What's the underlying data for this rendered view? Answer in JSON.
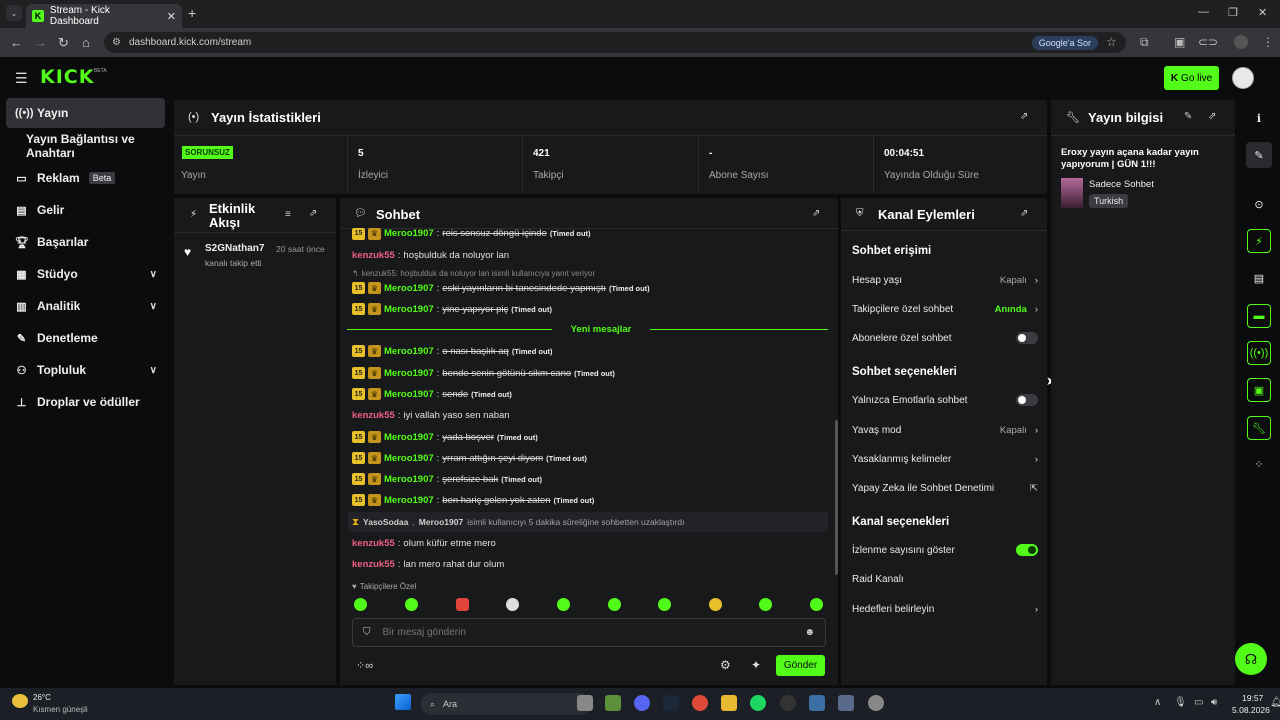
{
  "browser": {
    "tab_title": "Stream - Kick Dashboard",
    "tab_close": "✕",
    "new_tab": "+",
    "url": "dashboard.kick.com/stream",
    "google_sor": "Google'a Sor"
  },
  "header": {
    "logo": "KICK",
    "logo_beta": "BETA",
    "go_live": "Go live"
  },
  "sidebar": {
    "items": [
      {
        "label": "Yayın",
        "icon": "broadcast-icon"
      },
      {
        "label": "Yayın Bağlantısı ve Anahtarı",
        "icon": ""
      },
      {
        "label": "Reklam",
        "icon": "ad-icon",
        "badge": "Beta"
      },
      {
        "label": "Gelir",
        "icon": "revenue-icon"
      },
      {
        "label": "Başarılar",
        "icon": "trophy-icon"
      },
      {
        "label": "Stüdyo",
        "icon": "studio-icon"
      },
      {
        "label": "Analitik",
        "icon": "analytics-icon"
      },
      {
        "label": "Denetleme",
        "icon": "moderation-icon"
      },
      {
        "label": "Topluluk",
        "icon": "community-icon"
      },
      {
        "label": "Droplar ve ödüller",
        "icon": "drops-icon"
      }
    ]
  },
  "stats": {
    "title": "Yayın İstatistikleri",
    "status_badge": "SORUNSUZ",
    "status_label": "Yayın",
    "viewers_value": "5",
    "viewers_label": "İzleyici",
    "followers_value": "421",
    "followers_label": "Takipçi",
    "subs_value": "-",
    "subs_label": "Abone Sayısı",
    "uptime_value": "00:04:51",
    "uptime_label": "Yayında Olduğu Süre"
  },
  "activity": {
    "title": "Etkinlik Akışı",
    "user": "S2GNathan7",
    "time": "20 saat önce",
    "text": "kanalı takip etti"
  },
  "chat": {
    "title": "Sohbet",
    "lines": [
      {
        "user": "Meroo1907",
        "msg": "reis sonsuz döngü içinde",
        "to": "(Timed out)"
      },
      {
        "user": "kenzuk55",
        "msg": "hoşbulduk da noluyor lan"
      },
      {
        "reply": "kenzuk55: hoşbulduk da noluyor lan isimli kullanıcıya yanıt veriyor"
      },
      {
        "user": "Meroo1907",
        "msg": "eski yayınların bi tanesindede yapmıştı",
        "to": "(Timed out)"
      },
      {
        "user": "Meroo1907",
        "msg": "yine yapıyor piç",
        "to": "(Timed out)"
      },
      {
        "user": "Meroo1907",
        "msg": "o nası başlık aq",
        "to": "(Timed out)"
      },
      {
        "user": "Meroo1907",
        "msg": "bende senin götünü sikm cano",
        "to": "(Timed out)"
      },
      {
        "user": "Meroo1907",
        "msg": "sende",
        "to": "(Timed out)"
      },
      {
        "user": "kenzuk55",
        "msg": "iyi vallah yaso sen naban"
      },
      {
        "user": "Meroo1907",
        "msg": "yada boşver",
        "to": "(Timed out)"
      },
      {
        "user": "Meroo1907",
        "msg": "yrram attığın şeyi diyom",
        "to": "(Timed out)"
      },
      {
        "user": "Meroo1907",
        "msg": "şerefsize bak",
        "to": "(Timed out)"
      },
      {
        "user": "Meroo1907",
        "msg": "ben hariç gelen yok zaten",
        "to": "(Timed out)"
      },
      {
        "user": "kenzuk55",
        "msg": "olum küfür etme mero"
      },
      {
        "user": "kenzuk55",
        "msg": "lan mero rahat dur olum"
      }
    ],
    "new_messages": "Yeni mesajlar",
    "mod_user": "YasoSodaa",
    "mod_sep": ",",
    "mod_target": "Meroo1907",
    "mod_text": "isimli kullanıcıyı 5 dakika süreliğine sohbetten uzaklaştırdı",
    "followers_only": "Takipçilere Özel",
    "input_placeholder": "Bir mesaj gönderin",
    "send": "Gönder"
  },
  "channel": {
    "title": "Kanal Eylemleri",
    "chat_access": "Sohbet erişimi",
    "account_age": "Hesap yaşı",
    "account_age_val": "Kapalı",
    "followers_chat": "Takipçilere özel sohbet",
    "followers_chat_val": "Anında",
    "subs_chat": "Abonelere özel sohbet",
    "chat_options": "Sohbet seçenekleri",
    "emote_only": "Yalnızca Emotlarla sohbet",
    "slow_mode": "Yavaş mod",
    "slow_mode_val": "Kapalı",
    "banned_words": "Yasaklanmış kelimeler",
    "ai_mod": "Yapay Zeka ile Sohbet Denetimi",
    "channel_options": "Kanal seçenekleri",
    "show_views": "İzlenme sayısını göster",
    "raid": "Raid Kanalı",
    "goals": "Hedefleri belirleyin",
    "accent": "#53fc18"
  },
  "info": {
    "title": "Yayın bilgisi",
    "stream_title": "Eroxy yayın açana kadar yayın yapıyorum | GÜN 1!!!",
    "category": "Sadece Sohbet",
    "tag": "Turkish"
  },
  "taskbar": {
    "temp": "26°C",
    "weather": "Kısmen güneşli",
    "search": "Ara",
    "time": "19:57",
    "date": "5.08.2026"
  }
}
